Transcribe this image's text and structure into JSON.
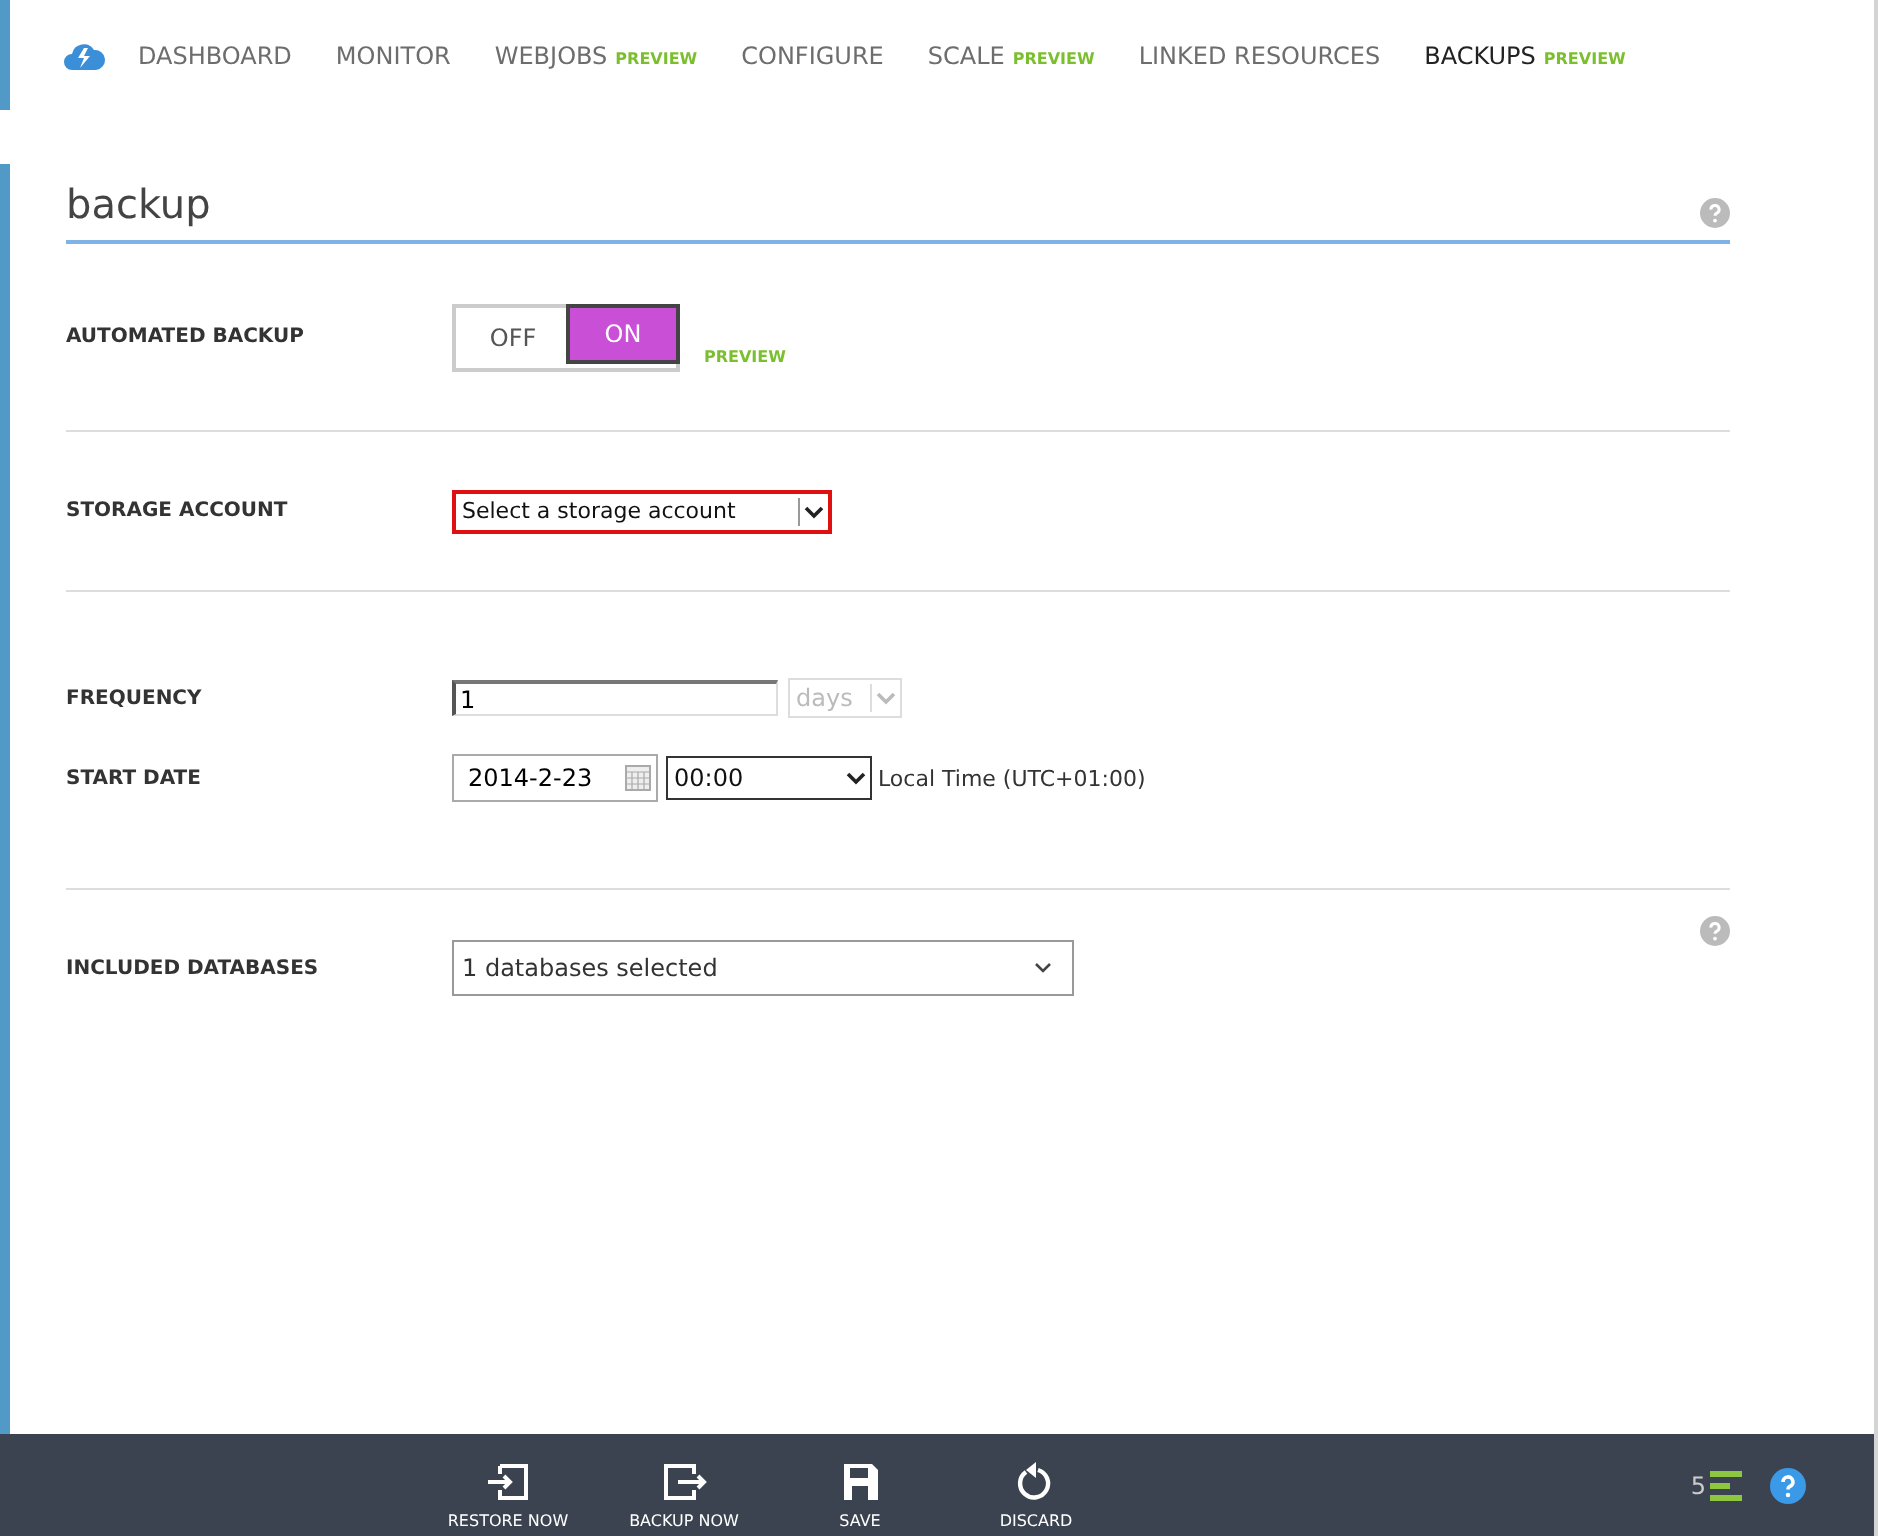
{
  "nav": {
    "tabs": [
      {
        "label": "DASHBOARD",
        "selected": false
      },
      {
        "label": "MONITOR",
        "selected": false
      },
      {
        "label": "WEBJOBS",
        "badge": "PREVIEW",
        "selected": false
      },
      {
        "label": "CONFIGURE",
        "selected": false
      },
      {
        "label": "SCALE",
        "badge": "PREVIEW",
        "selected": false
      },
      {
        "label": "LINKED RESOURCES",
        "selected": false
      },
      {
        "label": "BACKUPS",
        "badge": "PREVIEW",
        "selected": true
      }
    ]
  },
  "section": {
    "title": "backup"
  },
  "automated_backup": {
    "label": "AUTOMATED BACKUP",
    "options": [
      {
        "label": "OFF",
        "selected": false
      },
      {
        "label": "ON",
        "selected": true
      }
    ],
    "badge": "PREVIEW"
  },
  "storage_account": {
    "label": "STORAGE ACCOUNT",
    "value": "Select a storage account",
    "invalid": true
  },
  "frequency": {
    "label": "FREQUENCY",
    "value": "1",
    "unit": "days",
    "unit_disabled": true
  },
  "start_date": {
    "label": "START DATE",
    "date": "2014-2-23",
    "time": "00:00",
    "timezone": "Local Time (UTC+01:00)"
  },
  "included_databases": {
    "label": "INCLUDED DATABASES",
    "value": "1 databases selected"
  },
  "command_bar": {
    "buttons": [
      {
        "label": "RESTORE NOW",
        "kind": "restore"
      },
      {
        "label": "BACKUP NOW",
        "kind": "backup"
      },
      {
        "label": "SAVE",
        "kind": "save"
      },
      {
        "label": "DISCARD",
        "kind": "discard"
      }
    ],
    "notification_count": "5"
  }
}
